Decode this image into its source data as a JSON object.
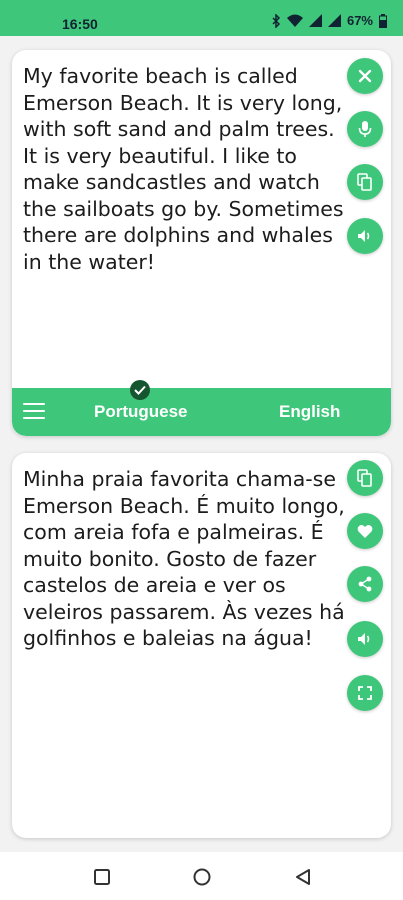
{
  "status": {
    "time": "16:50",
    "battery": "67%"
  },
  "source": {
    "text": "My favorite beach is called Emerson Beach. It is very long, with soft sand and palm trees. It is very beautiful. I like to make sandcastles and watch the sailboats go by. Sometimes there are dolphins and whales in the water!"
  },
  "languages": {
    "source": "Portuguese",
    "target": "English"
  },
  "translation": {
    "text": "Minha praia favorita chama-se Emerson Beach. É muito longo, com areia fofa e palmeiras. É muito bonito. Gosto de fazer castelos de areia e ver os veleiros passarem. Às vezes há golfinhos e baleias na água!"
  },
  "icons": {
    "source_actions": [
      "close-icon",
      "microphone-icon",
      "copy-icon",
      "speaker-icon"
    ],
    "target_actions": [
      "copy-icon",
      "heart-icon",
      "share-icon",
      "speaker-icon",
      "fullscreen-icon"
    ],
    "nav": [
      "recent-apps-icon",
      "home-icon",
      "back-icon"
    ]
  },
  "colors": {
    "accent": "#3ec77a",
    "badge": "#15552f",
    "text": "#1c1c1c"
  }
}
